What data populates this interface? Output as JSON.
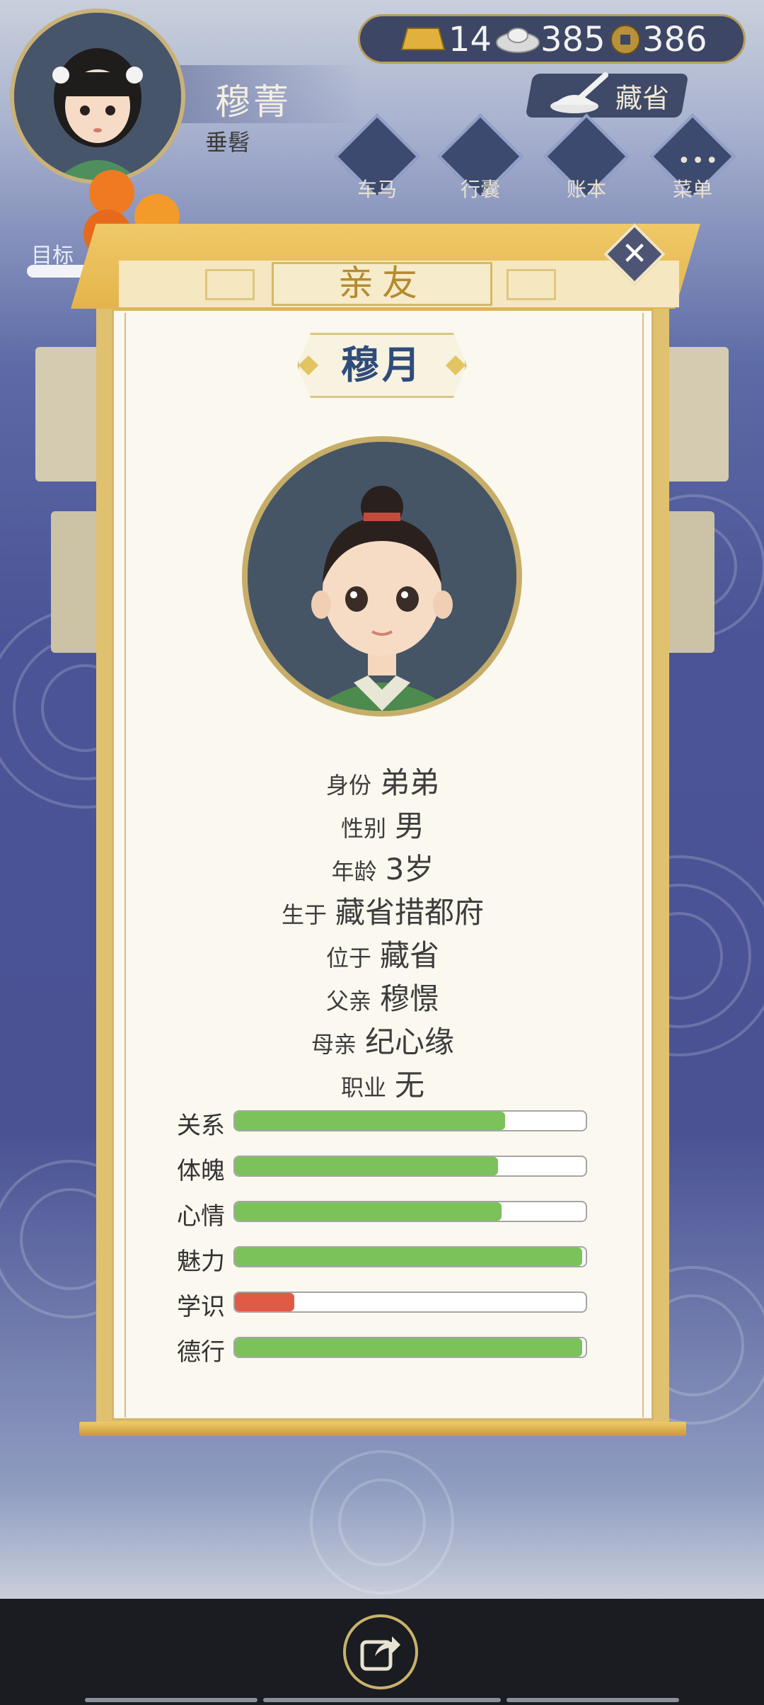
{
  "hud": {
    "player_name": "穆菁",
    "player_title": "垂髫",
    "gold": "14",
    "silver": "385",
    "coins": "386",
    "region": "藏省",
    "goal_label": "目标",
    "menu": [
      {
        "label": "车马",
        "icon": "carriage-icon"
      },
      {
        "label": "行囊",
        "icon": "bag-icon"
      },
      {
        "label": "账本",
        "icon": "ledger-icon"
      },
      {
        "label": "菜单",
        "icon": "more-icon"
      }
    ]
  },
  "dialog": {
    "title": "亲友",
    "person_name": "穆月",
    "info": [
      {
        "label": "身份",
        "value": "弟弟"
      },
      {
        "label": "性别",
        "value": "男"
      },
      {
        "label": "年龄",
        "value": "3岁"
      },
      {
        "label": "生于",
        "value": "藏省措都府"
      },
      {
        "label": "位于",
        "value": "藏省"
      },
      {
        "label": "父亲",
        "value": "穆憬"
      },
      {
        "label": "母亲",
        "value": "纪心缘"
      },
      {
        "label": "职业",
        "value": "无"
      }
    ],
    "stats": [
      {
        "label": "关系",
        "value": 0.77,
        "color": "#7bc25a"
      },
      {
        "label": "体魄",
        "value": 0.75,
        "color": "#7bc25a"
      },
      {
        "label": "心情",
        "value": 0.76,
        "color": "#7bc25a"
      },
      {
        "label": "魅力",
        "value": 0.99,
        "color": "#7bc25a"
      },
      {
        "label": "学识",
        "value": 0.17,
        "color": "#e05a45"
      },
      {
        "label": "德行",
        "value": 0.99,
        "color": "#7bc25a"
      }
    ]
  }
}
